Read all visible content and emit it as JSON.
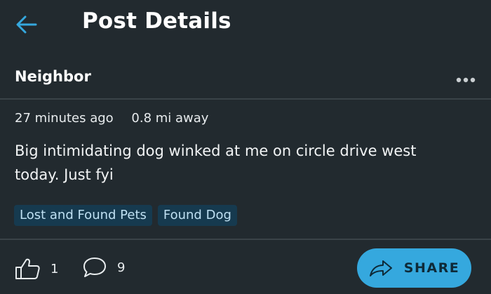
{
  "header": {
    "title": "Post Details",
    "back_icon": "arrow-left-icon",
    "accent_color": "#35a8de"
  },
  "post": {
    "author": "Neighbor",
    "time_ago": "27 minutes ago",
    "distance": "0.8 mi away",
    "body": "Big intimidating dog winked at me on circle drive west today. Just fyi",
    "tags": [
      "Lost and Found Pets",
      "Found Dog"
    ]
  },
  "actions": {
    "like_count": "1",
    "comment_count": "9",
    "share_label": "SHARE"
  }
}
